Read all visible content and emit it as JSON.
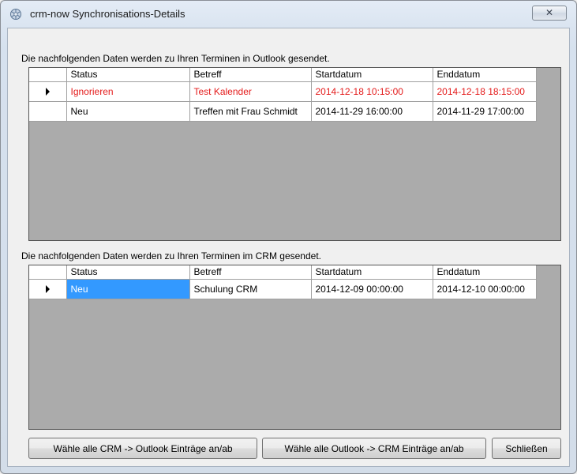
{
  "window": {
    "title": "crm-now Synchronisations-Details",
    "close_glyph": "✕"
  },
  "outlook_section": {
    "label": "Die nachfolgenden Daten werden zu Ihren Terminen in Outlook gesendet.",
    "columns": [
      "Status",
      "Betreff",
      "Startdatum",
      "Enddatum"
    ],
    "rows": [
      {
        "status": "Ignorieren",
        "betreff": "Test Kalender",
        "start": "2014-12-18 10:15:00",
        "end": "2014-12-18 18:15:00",
        "color": "#e41b1b",
        "current": true
      },
      {
        "status": "Neu",
        "betreff": "Treffen mit Frau Schmidt",
        "start": "2014-11-29 16:00:00",
        "end": "2014-11-29 17:00:00",
        "color": "#000000",
        "current": false
      }
    ]
  },
  "crm_section": {
    "label": "Die nachfolgenden Daten werden zu Ihren Terminen im CRM gesendet.",
    "columns": [
      "Status",
      "Betreff",
      "Startdatum",
      "Enddatum"
    ],
    "rows": [
      {
        "status": "Neu",
        "betreff": "Schulung CRM",
        "start": "2014-12-09 00:00:00",
        "end": "2014-12-10 00:00:00",
        "color": "#000000",
        "current": true,
        "selected_cell": "status"
      }
    ]
  },
  "buttons": {
    "toggle_crm_to_outlook": "Wähle alle CRM -> Outlook Einträge an/ab",
    "toggle_outlook_to_crm": "Wähle alle Outlook -> CRM Einträge an/ab",
    "close": "Schließen"
  },
  "colors": {
    "selection": "#3399ff",
    "ignored_text": "#e41b1b",
    "grid_background": "#ababab"
  }
}
